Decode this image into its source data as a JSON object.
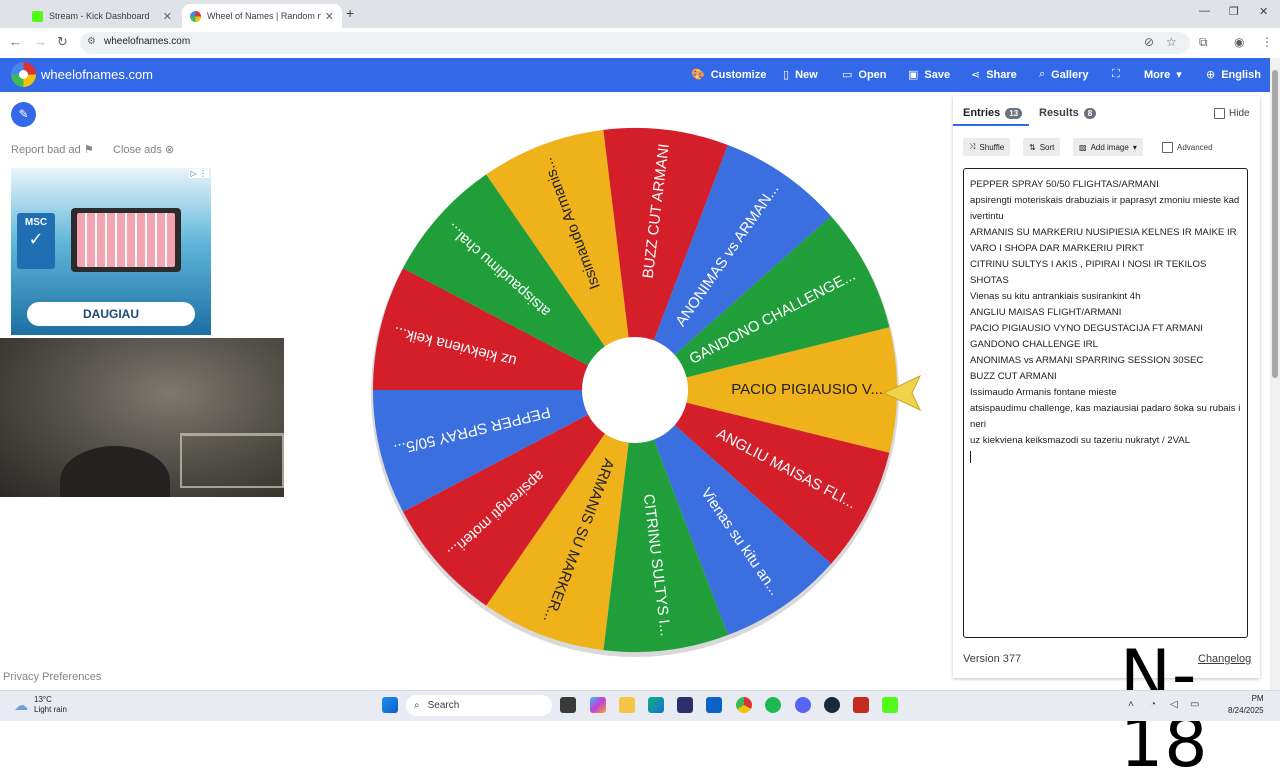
{
  "browser": {
    "tabs": [
      {
        "title": "Stream - Kick Dashboard",
        "active": false,
        "favicon_color": "#53fc18"
      },
      {
        "title": "Wheel of Names | Random nam",
        "active": true,
        "favicon_color": "#3369e8"
      }
    ],
    "url": "wheelofnames.com"
  },
  "site": {
    "name": "wheelofnames.com",
    "brand_color": "#3369e8",
    "menu": [
      {
        "label": "Customize",
        "icon": "palette-icon"
      },
      {
        "label": "New",
        "icon": "file-icon"
      },
      {
        "label": "Open",
        "icon": "folder-icon"
      },
      {
        "label": "Save",
        "icon": "save-icon"
      },
      {
        "label": "Share",
        "icon": "share-icon"
      },
      {
        "label": "Gallery",
        "icon": "search-icon"
      },
      {
        "label": "",
        "icon": "fullscreen-icon"
      },
      {
        "label": "More",
        "icon": "chevron-down-icon"
      },
      {
        "label": "English",
        "icon": "globe-icon"
      }
    ]
  },
  "left": {
    "report_ad": "Report bad ad",
    "close_ads": "Close ads",
    "ad": {
      "brand": "MSC",
      "cta": "DAUGIAU"
    },
    "privacy": "Privacy Preferences"
  },
  "wheel": {
    "colors": {
      "red": "#d41f2a",
      "blue": "#3b6fe0",
      "green": "#1f9e3a",
      "yellow": "#efb21a"
    },
    "segments": [
      {
        "label": "PACIO PIGIAUSIO V...",
        "color": "yellow"
      },
      {
        "label": "ANGLIU MAISAS FLI...",
        "color": "red"
      },
      {
        "label": "Vienas su kitu an...",
        "color": "blue"
      },
      {
        "label": "CITRINU SULTYS I...",
        "color": "green"
      },
      {
        "label": "ARMANIS SU MARKER...",
        "color": "yellow"
      },
      {
        "label": "apsirengti moteri...",
        "color": "red"
      },
      {
        "label": "PEPPER SPRAY 50/5...",
        "color": "blue"
      },
      {
        "label": "uz kiekviena keik...",
        "color": "red"
      },
      {
        "label": "atsispaudimu chal...",
        "color": "green"
      },
      {
        "label": "Issimaudo Armanis...",
        "color": "yellow"
      },
      {
        "label": "BUZZ CUT ARMANI",
        "color": "red"
      },
      {
        "label": "ANONIMAS vs ARMAN...",
        "color": "blue"
      },
      {
        "label": "GANDONO CHALLENGE...",
        "color": "green"
      }
    ]
  },
  "panel": {
    "entries_tab": "Entries",
    "entries_count": "13",
    "results_tab": "Results",
    "results_count": "8",
    "hide_label": "Hide",
    "toolbar": {
      "shuffle": "Shuffle",
      "sort": "Sort",
      "add_image": "Add image",
      "advanced": "Advanced"
    },
    "entries": [
      "PEPPER SPRAY 50/50 FLIGHTAS/ARMANI",
      "apsirengti moteriskais drabuziais ir paprasyt zmoniu mieste kad ivertintu",
      "ARMANIS SU MARKERIU NUSIPIESIA KELNES IR MAIKE IR VARO I SHOPA DAR MARKERIU PIRKT",
      "CITRINU SULTYS I AKIS , PIPIRAI I NOSI IR TEKILOS SHOTAS",
      "Vienas su kitu antrankiais susirankint 4h",
      "ANGLIU MAISAS FLIGHT/ARMANI",
      "PACIO PIGIAUSIO VYNO DEGUSTACIJA FT ARMANI",
      "GANDONO CHALLENGE IRL",
      "ANONIMAS vs ARMANI SPARRING SESSION 30SEC",
      "BUZZ CUT ARMANI",
      "Issimaudo Armanis fontane mieste",
      "atsispaudimu challenge, kas maziausiai padaro šoka su rubais i neri",
      "uz kiekviena keiksmazodi su tazeriu nukratyt / 2VAL"
    ],
    "version": "Version 377",
    "changelog": "Changelog"
  },
  "overlay": {
    "watermark": "N-18"
  },
  "taskbar": {
    "temp": "13°C",
    "condition": "Light rain",
    "search": "Search",
    "date": "8/24/2025",
    "time": "PM"
  }
}
